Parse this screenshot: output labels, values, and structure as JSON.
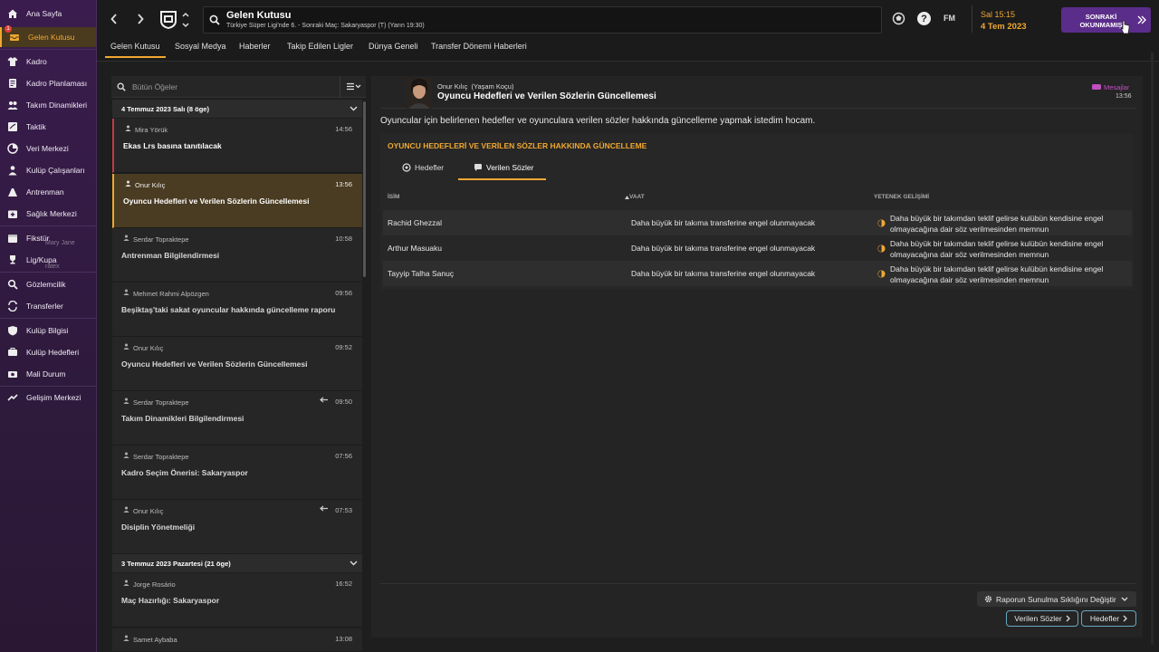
{
  "sidebar": {
    "items": [
      {
        "label": "Ana Sayfa",
        "icon": "home-icon"
      },
      {
        "label": "Gelen Kutusu",
        "icon": "inbox-icon",
        "badge": "1"
      },
      {
        "label": "Kadro",
        "icon": "shirt-icon"
      },
      {
        "label": "Kadro Planlaması",
        "icon": "planning-icon"
      },
      {
        "label": "Takım Dinamikleri",
        "icon": "dynamics-icon"
      },
      {
        "label": "Taktik",
        "icon": "tactics-icon"
      },
      {
        "label": "Veri Merkezi",
        "icon": "data-icon"
      },
      {
        "label": "Kulüp Çalışanları",
        "icon": "staff-icon"
      },
      {
        "label": "Antrenman",
        "icon": "training-icon"
      },
      {
        "label": "Sağlık Merkezi",
        "icon": "medical-icon"
      },
      {
        "label": "Fikstür",
        "icon": "calendar-icon"
      },
      {
        "label": "Lig/Kupa",
        "icon": "trophy-icon"
      },
      {
        "label": "Gözlemcilik",
        "icon": "scouting-icon"
      },
      {
        "label": "Transferler",
        "icon": "transfers-icon"
      },
      {
        "label": "Kulüp Bilgisi",
        "icon": "club-info-icon"
      },
      {
        "label": "Kulüp Hedefleri",
        "icon": "club-targets-icon"
      },
      {
        "label": "Mali Durum",
        "icon": "finance-icon"
      },
      {
        "label": "Gelişim Merkezi",
        "icon": "development-icon"
      }
    ],
    "ghost_labels": [
      "Mary Jane",
      "ratex"
    ]
  },
  "header": {
    "title": "Gelen Kutusu",
    "subtitle": "Türkiye Süper Ligi'nde 6. - Sonraki Maç: Sakaryaspor (T) (Yarın 19:30)",
    "fm_label": "FM",
    "date_time": "Sal 15:15",
    "date": "4 Tem 2023",
    "next_button": "SONRAKİ OKUNMAMIŞ"
  },
  "tabs": [
    "Gelen Kutusu",
    "Sosyal Medya",
    "Haberler",
    "Takip Edilen Ligler",
    "Dünya Geneli",
    "Transfer Dönemi Haberleri"
  ],
  "list": {
    "search_placeholder": "Bütün Öğeler",
    "group1": "4 Temmuz 2023 Salı (8 öge)",
    "group2": "3 Temmuz 2023 Pazartesi (21 öge)",
    "messages": [
      {
        "from": "Mira Yörük",
        "time": "14:56",
        "subject": "Ekas Lrs basına tanıtılacak"
      },
      {
        "from": "Onur Kılıç",
        "time": "13:56",
        "subject": "Oyuncu Hedefleri ve Verilen Sözlerin Güncellemesi"
      },
      {
        "from": "Serdar Topraktepe",
        "time": "10:58",
        "subject": "Antrenman Bilgilendirmesi"
      },
      {
        "from": "Mehmet Rahmi Alpözgen",
        "time": "09:56",
        "subject": "Beşiktaş'taki sakat oyuncular hakkında güncelleme raporu"
      },
      {
        "from": "Onur Kılıç",
        "time": "09:52",
        "subject": "Oyuncu Hedefleri ve Verilen Sözlerin Güncellemesi"
      },
      {
        "from": "Serdar Topraktepe",
        "time": "09:50",
        "subject": "Takım Dinamikleri Bilgilendirmesi"
      },
      {
        "from": "Serdar Topraktepe",
        "time": "07:56",
        "subject": "Kadro Seçim Önerisi: Sakaryaspor"
      },
      {
        "from": "Onur Kılıç",
        "time": "07:53",
        "subject": "Disiplin Yönetmeliği"
      },
      {
        "from": "Jorge Rosário",
        "time": "16:52",
        "subject": "Maç Hazırlığı: Sakaryaspor"
      },
      {
        "from": "Samet Aybaba",
        "time": "13:08",
        "subject": ""
      }
    ]
  },
  "detail": {
    "sender": "Onur Kılıç  (Yaşam Koçu)",
    "title": "Oyuncu Hedefleri ve Verilen Sözlerin Güncellemesi",
    "category": "Mesajlar",
    "time": "13:56",
    "intro": "Oyuncular için belirlenen hedefler ve oyunculara verilen sözler hakkında güncelleme yapmak istedim hocam.",
    "section_title": "OYUNCU HEDEFLERİ VE VERİLEN SÖZLER HAKKINDA GÜNCELLEME",
    "subtabs": [
      "Hedefler",
      "Verilen Sözler"
    ],
    "columns": [
      "İSİM",
      "VAAT",
      "YETENEK GELİŞİMİ"
    ],
    "rows": [
      {
        "name": "Rachid Ghezzal",
        "promise": "Daha büyük bir takıma transferine engel olunmayacak",
        "development_1": "Daha büyük bir takımdan teklif gelirse kulübün kendisine engel",
        "development_2": "olmayacağına dair söz verilmesinden memnun"
      },
      {
        "name": "Arthur Masuaku",
        "promise": "Daha büyük bir takıma transferine engel olunmayacak",
        "development_1": "Daha büyük bir takımdan teklif gelirse kulübün kendisine engel",
        "development_2": "olmayacağına dair söz verilmesinden memnun"
      },
      {
        "name": "Tayyip Talha Sanuç",
        "promise": "Daha büyük bir takıma transferine engel olunmayacak",
        "development_1": "Daha büyük bir takımdan teklif gelirse kulübün kendisine engel",
        "development_2": "olmayacağına dair söz verilmesinden memnun"
      }
    ],
    "frequency_button": "Raporun Sunulma Sıklığını Değiştir",
    "action_buttons": [
      "Verilen Sözler",
      "Hedefler"
    ]
  },
  "colors": {
    "accent": "#f0a830",
    "sidebar": "#341b46",
    "next_button": "#5b2d8a",
    "outline": "#6aa7c0"
  }
}
